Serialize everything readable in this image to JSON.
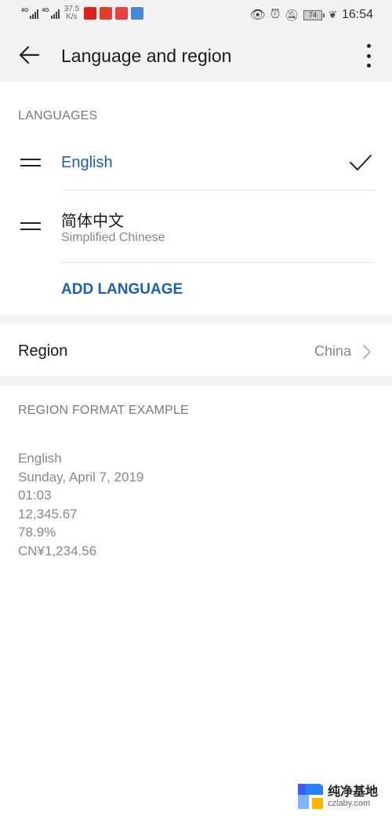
{
  "status_bar": {
    "network_1": "4G",
    "network_2": "4G",
    "speed_value": "37.5",
    "speed_unit": "K/s",
    "battery_level": "74",
    "time": "16:54",
    "app_icons": [
      "stock-app-icon",
      "video-app-icon",
      "trend-app-icon",
      "chart-app-icon"
    ],
    "indicator_icons": [
      "eye-comfort-icon",
      "alarm-icon",
      "mute-bell-icon",
      "battery-icon",
      "power-saving-leaf-icon"
    ]
  },
  "app_bar": {
    "title": "Language and region",
    "back_icon": "arrow-left-icon",
    "menu_icon": "more-vert-icon"
  },
  "languages": {
    "header": "LANGUAGES",
    "items": [
      {
        "label": "English",
        "selected": true
      },
      {
        "label": "简体中文",
        "sublabel": "Simplified Chinese",
        "selected": false
      }
    ],
    "add_label": "ADD LANGUAGE"
  },
  "region": {
    "label": "Region",
    "value": "China"
  },
  "format_example": {
    "header": "REGION FORMAT EXAMPLE",
    "lines": [
      "English",
      "Sunday, April 7, 2019",
      "01:03",
      "12,345.67",
      "78.9%",
      "CN¥1,234.56"
    ]
  },
  "watermark": {
    "title": "纯净基地",
    "url": "czlaby.com"
  },
  "colors": {
    "accent": "#1f5fa8",
    "background": "#ffffff",
    "bar_background": "#f2f2f2",
    "secondary_text": "#888888"
  }
}
